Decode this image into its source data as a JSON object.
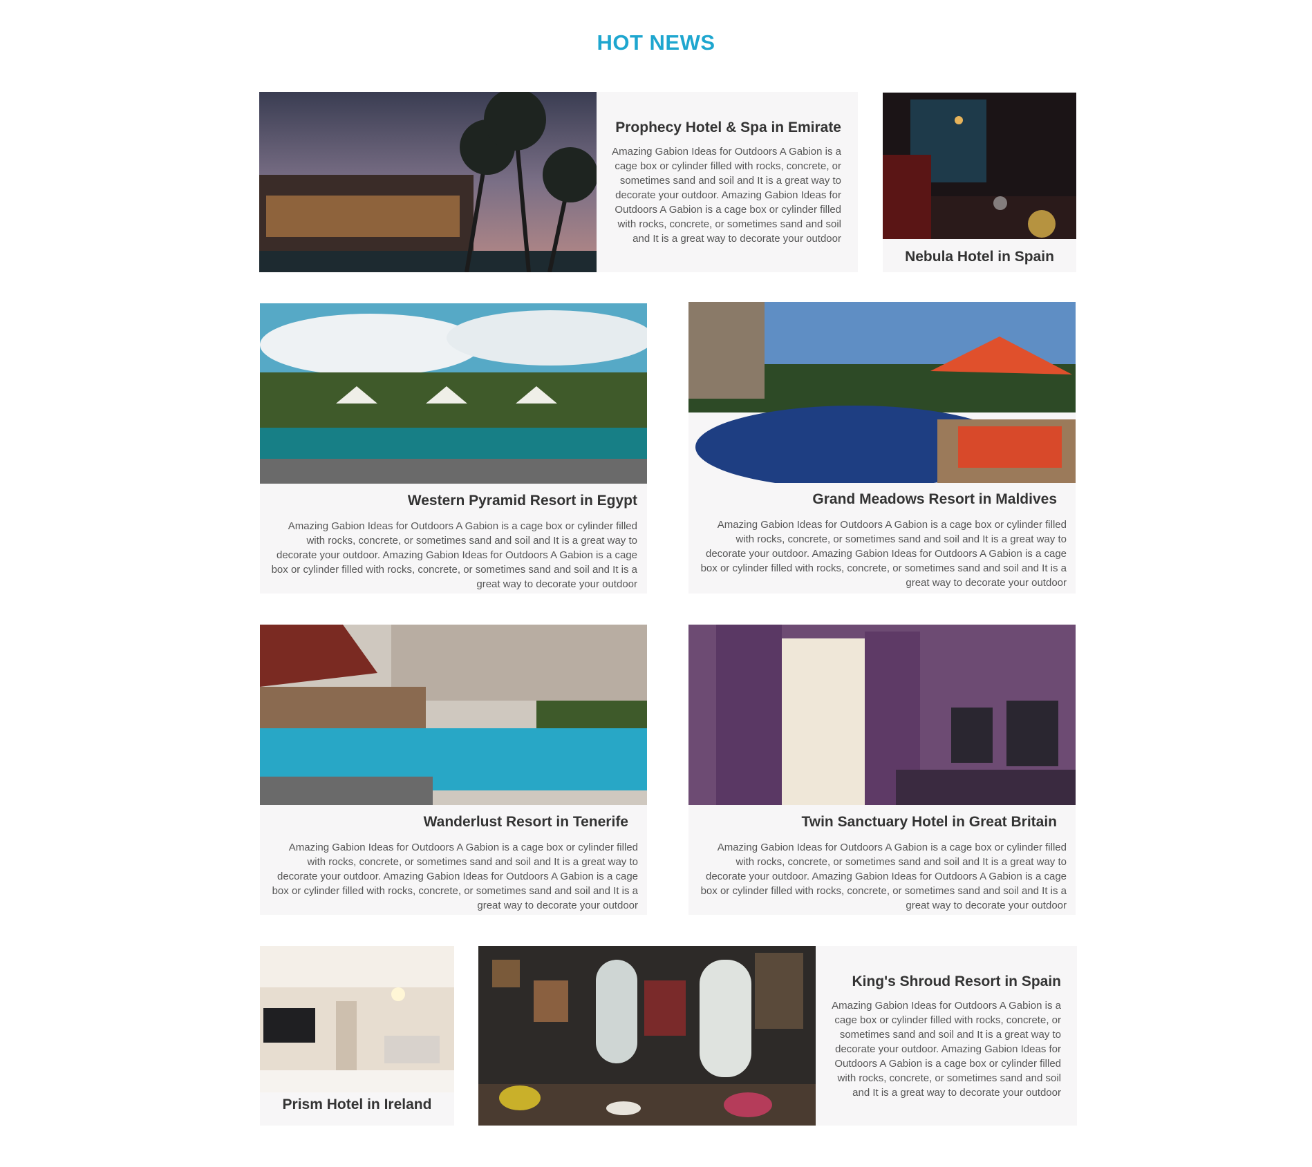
{
  "section_title": "HOT NEWS",
  "body_text": "Amazing Gabion Ideas for Outdoors A Gabion is a cage box or cylinder filled with rocks, concrete, or sometimes sand and soil and It is a great way to decorate your outdoor. Amazing Gabion Ideas for Outdoors A Gabion is a cage box or cylinder filled with rocks, concrete, or sometimes sand and soil and It is a great way to decorate your outdoor",
  "articles": [
    {
      "title": "Prophecy Hotel & Spa in Emirate",
      "image": "palm-trees-resort-dusk-photo"
    },
    {
      "title": "Nebula Hotel in Spain",
      "image": "restaurant-interior-photo"
    },
    {
      "title": "Western Pyramid Resort in Egypt",
      "image": "pool-with-umbrellas-photo"
    },
    {
      "title": "Grand Meadows Resort in Maldives",
      "image": "infinity-pool-red-umbrella-photo"
    },
    {
      "title": "Wanderlust Resort in Tenerife",
      "image": "resort-pool-building-photo"
    },
    {
      "title": "Twin Sanctuary Hotel in Great Britain",
      "image": "purple-hotel-room-photo"
    },
    {
      "title": "Prism Hotel in Ireland",
      "image": "bright-hotel-room-photo"
    },
    {
      "title": "King's Shroud Resort in Spain",
      "image": "vintage-lounge-photo"
    }
  ]
}
